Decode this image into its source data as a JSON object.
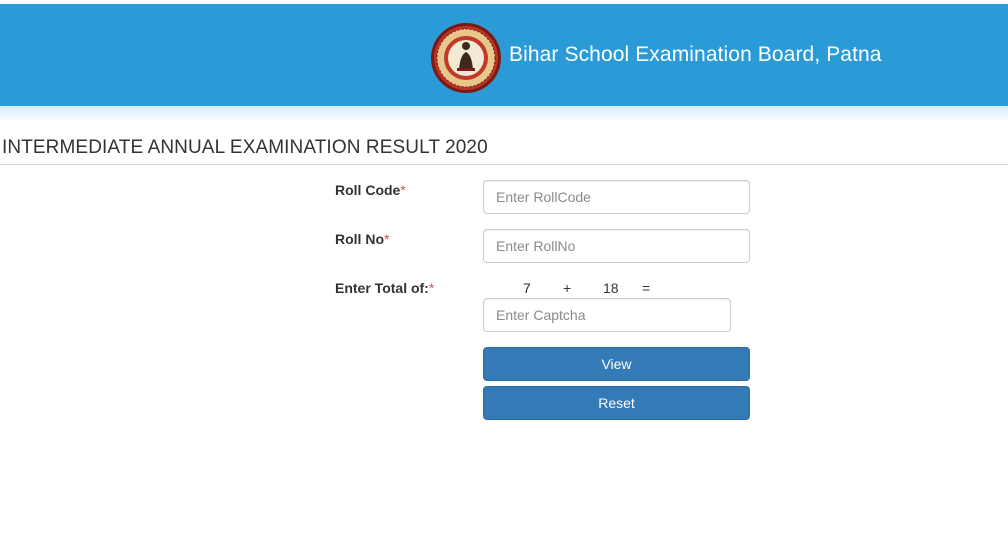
{
  "header": {
    "board_name": "Bihar School Examination Board, Patna",
    "logo_icon": "bseb-emblem-icon",
    "background_color": "#2a9bd6"
  },
  "page": {
    "title": "INTERMEDIATE ANNUAL EXAMINATION RESULT 2020"
  },
  "form": {
    "roll_code": {
      "label": "Roll Code",
      "required_mark": "*",
      "value": "",
      "placeholder": "Enter RollCode"
    },
    "roll_no": {
      "label": "Roll No",
      "required_mark": "*",
      "value": "",
      "placeholder": "Enter RollNo"
    },
    "captcha": {
      "label": "Enter Total of:",
      "required_mark": "*",
      "operand_a": "7",
      "operator": "+",
      "operand_b": "18",
      "equals": "=",
      "value": "",
      "placeholder": "Enter Captcha"
    },
    "view_label": "View",
    "reset_label": "Reset",
    "button_color": "#337ab7",
    "required_color": "#d9534f"
  }
}
